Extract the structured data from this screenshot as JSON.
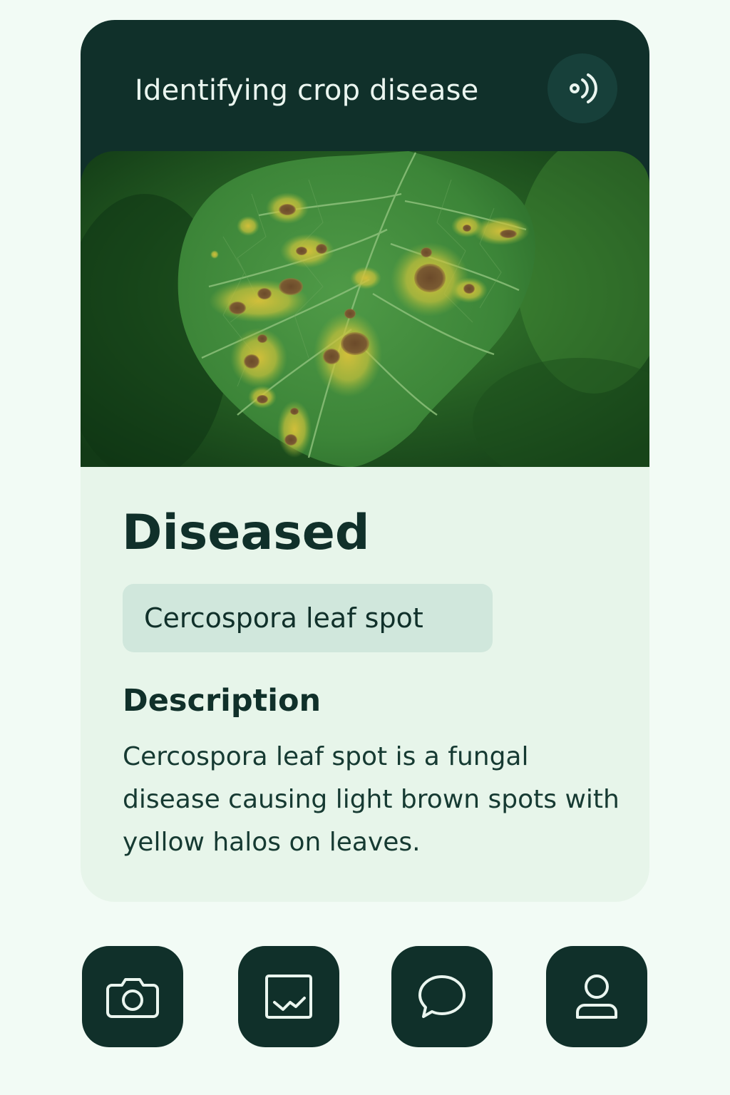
{
  "header": {
    "title": "Identifying crop disease",
    "speak_icon": "sound-waves-icon"
  },
  "image": {
    "subject": "leaf-photo"
  },
  "result": {
    "status": "Diseased",
    "disease_name": "Cercospora leaf spot",
    "description_heading": "Description",
    "description": "Cercospora leaf spot is a fungal disease causing light brown spots with yellow halos on leaves."
  },
  "bottom_nav": {
    "items": [
      {
        "icon": "camera-icon"
      },
      {
        "icon": "image-icon"
      },
      {
        "icon": "chat-icon"
      },
      {
        "icon": "user-icon"
      }
    ]
  },
  "colors": {
    "background": "#f2fbf5",
    "header": "#10302a",
    "card": "#e7f5ea",
    "chip": "#d0e7dc",
    "text_dark": "#10302a"
  }
}
